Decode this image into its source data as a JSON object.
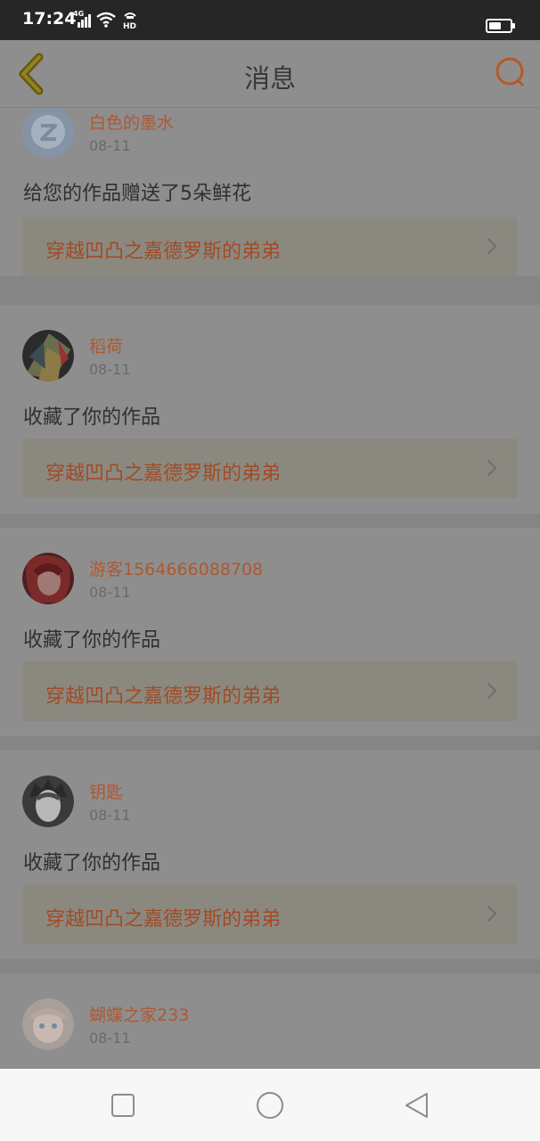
{
  "status_bar": {
    "time": "17:24",
    "network": "4G",
    "icons": [
      "signal-icon",
      "wifi-icon",
      "hd-icon",
      "battery-icon"
    ]
  },
  "header": {
    "title": "消息",
    "back_icon": "chevron-left-icon",
    "search_icon": "search-icon"
  },
  "colors": {
    "accent": "#b0572f",
    "text": "#303030",
    "overlay_background": "#8e8e8e"
  },
  "messages": [
    {
      "username": "白色的墨水",
      "date": "08-11",
      "action": "给您的作品赠送了5朵鲜花",
      "work": "穿越凹凸之嘉德罗斯的弟弟"
    },
    {
      "username": "稻荷",
      "date": "08-11",
      "action": "收藏了你的作品",
      "work": "穿越凹凸之嘉德罗斯的弟弟"
    },
    {
      "username": "游客1564666088708",
      "date": "08-11",
      "action": "收藏了你的作品",
      "work": "穿越凹凸之嘉德罗斯的弟弟"
    },
    {
      "username": "钥匙",
      "date": "08-11",
      "action": "收藏了你的作品",
      "work": "穿越凹凸之嘉德罗斯的弟弟"
    },
    {
      "username": "蝴蝶之家233",
      "date": "08-11",
      "action": "",
      "work": ""
    }
  ],
  "system_nav": {
    "icons": [
      "square-recent-apps-icon",
      "circle-home-icon",
      "triangle-back-icon"
    ]
  }
}
